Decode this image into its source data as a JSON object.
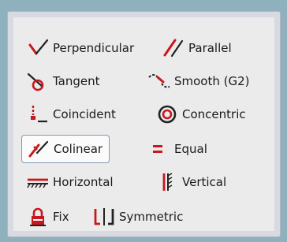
{
  "palette": {
    "colors": {
      "icon_red": "#c8181e",
      "icon_dark": "#222222",
      "selected_border": "#7d9bb8"
    },
    "tools": [
      {
        "key": "perpendicular",
        "label": "Perpendicular",
        "icon": "perpendicular-icon"
      },
      {
        "key": "parallel",
        "label": "Parallel",
        "icon": "parallel-icon"
      },
      {
        "key": "tangent",
        "label": "Tangent",
        "icon": "tangent-icon"
      },
      {
        "key": "smooth",
        "label": "Smooth (G2)",
        "icon": "smooth-g2-icon"
      },
      {
        "key": "coincident",
        "label": "Coincident",
        "icon": "coincident-icon"
      },
      {
        "key": "concentric",
        "label": "Concentric",
        "icon": "concentric-icon"
      },
      {
        "key": "colinear",
        "label": "Colinear",
        "icon": "colinear-icon",
        "selected": true
      },
      {
        "key": "equal",
        "label": "Equal",
        "icon": "equal-icon"
      },
      {
        "key": "horizontal",
        "label": "Horizontal",
        "icon": "horizontal-icon"
      },
      {
        "key": "vertical",
        "label": "Vertical",
        "icon": "vertical-icon"
      },
      {
        "key": "fix",
        "label": "Fix",
        "icon": "lock-icon"
      },
      {
        "key": "symmetric",
        "label": "Symmetric",
        "icon": "symmetric-icon"
      }
    ]
  }
}
